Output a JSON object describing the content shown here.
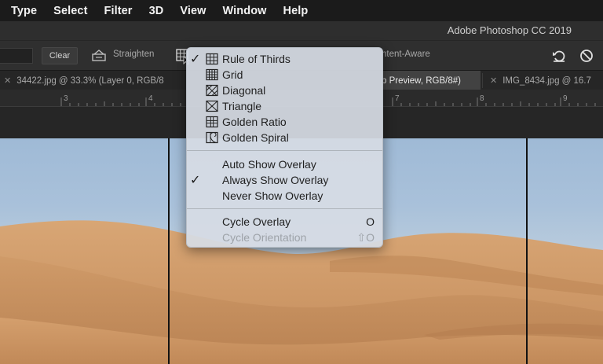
{
  "menubar": {
    "items": [
      "Type",
      "Select",
      "Filter",
      "3D",
      "View",
      "Window",
      "Help"
    ]
  },
  "titlebar": {
    "title": "Adobe Photoshop CC 2019"
  },
  "options": {
    "clear_label": "Clear",
    "straighten_label": "Straighten",
    "content_aware_label": "ntent-Aware"
  },
  "tabs": [
    {
      "label": "34422.jpg @ 33.3% (Layer 0, RGB/8",
      "active": false
    },
    {
      "label": "p Preview, RGB/8#)",
      "active": true
    },
    {
      "label": "IMG_8434.jpg @ 16.7",
      "active": false
    }
  ],
  "ruler": {
    "numbers": [
      "3",
      "4",
      "7",
      "8",
      "9"
    ]
  },
  "overlay_menu": {
    "overlays": [
      {
        "label": "Rule of Thirds",
        "icon": "rule-of-thirds-icon",
        "checked": true
      },
      {
        "label": "Grid",
        "icon": "grid-icon",
        "checked": false
      },
      {
        "label": "Diagonal",
        "icon": "diagonal-icon",
        "checked": false
      },
      {
        "label": "Triangle",
        "icon": "triangle-icon",
        "checked": false
      },
      {
        "label": "Golden Ratio",
        "icon": "golden-ratio-icon",
        "checked": false
      },
      {
        "label": "Golden Spiral",
        "icon": "golden-spiral-icon",
        "checked": false
      }
    ],
    "show_modes": [
      {
        "label": "Auto Show Overlay",
        "checked": false
      },
      {
        "label": "Always Show Overlay",
        "checked": true
      },
      {
        "label": "Never Show Overlay",
        "checked": false
      }
    ],
    "cycle": [
      {
        "label": "Cycle Overlay",
        "shortcut": "O",
        "disabled": false
      },
      {
        "label": "Cycle Orientation",
        "shortcut": "⇧O",
        "disabled": true
      }
    ],
    "checkmark": "✓"
  },
  "colors": {
    "sky": "#a9c1da",
    "sand_light": "#d9a777",
    "sand_dark": "#b47f52",
    "menu_bg": "#d6dce4"
  }
}
